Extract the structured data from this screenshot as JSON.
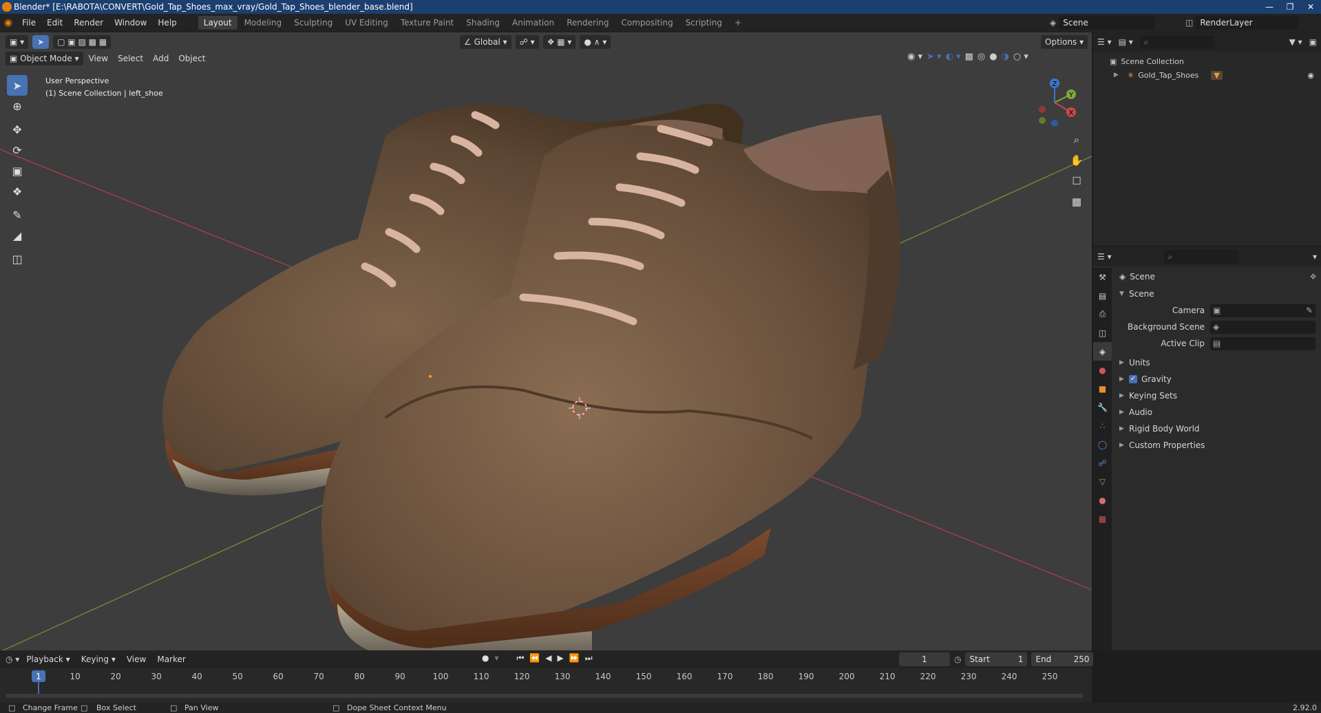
{
  "titlebar": {
    "text": "Blender* [E:\\RABOTA\\CONVERT\\Gold_Tap_Shoes_max_vray/Gold_Tap_Shoes_blender_base.blend]"
  },
  "menus": [
    "File",
    "Edit",
    "Render",
    "Window",
    "Help"
  ],
  "workspaces": [
    "Layout",
    "Modeling",
    "Sculpting",
    "UV Editing",
    "Texture Paint",
    "Shading",
    "Animation",
    "Rendering",
    "Compositing",
    "Scripting"
  ],
  "scene_field": "Scene",
  "render_layer": "RenderLayer",
  "viewport": {
    "transform_orientation": "Global",
    "options_label": "Options",
    "mode": "Object Mode",
    "menus": [
      "View",
      "Select",
      "Add",
      "Object"
    ],
    "info_line1": "User Perspective",
    "info_line2": "(1) Scene Collection | left_shoe",
    "gizmo_axes": {
      "x": "X",
      "y": "Y",
      "z": "Z"
    }
  },
  "outliner": {
    "root": "Scene Collection",
    "items": [
      "Gold_Tap_Shoes"
    ]
  },
  "properties": {
    "context": "Scene",
    "section": "Scene",
    "fields": [
      {
        "label": "Camera",
        "value": ""
      },
      {
        "label": "Background Scene",
        "value": ""
      },
      {
        "label": "Active Clip",
        "value": ""
      }
    ],
    "panels": [
      "Units",
      "Gravity",
      "Keying Sets",
      "Audio",
      "Rigid Body World",
      "Custom Properties"
    ],
    "gravity_checked": true
  },
  "timeline": {
    "menus": [
      "Playback",
      "Keying",
      "View",
      "Marker"
    ],
    "current_frame": "1",
    "start_label": "Start",
    "start": "1",
    "end_label": "End",
    "end": "250",
    "ticks": [
      "1",
      "10",
      "20",
      "30",
      "40",
      "50",
      "60",
      "70",
      "80",
      "90",
      "100",
      "110",
      "120",
      "130",
      "140",
      "150",
      "160",
      "170",
      "180",
      "190",
      "200",
      "210",
      "220",
      "230",
      "240",
      "250"
    ]
  },
  "statusbar": {
    "items": [
      "Change Frame",
      "Box Select",
      "Pan View",
      "Dope Sheet Context Menu"
    ],
    "version": "2.92.0"
  },
  "colors": {
    "accent": "#4772b3",
    "viewport_bg": "#3d3d3d",
    "leather": "#6e5540",
    "x_axis": "#c8474e",
    "y_axis": "#7fa63a",
    "z_axis": "#3a76cf"
  }
}
